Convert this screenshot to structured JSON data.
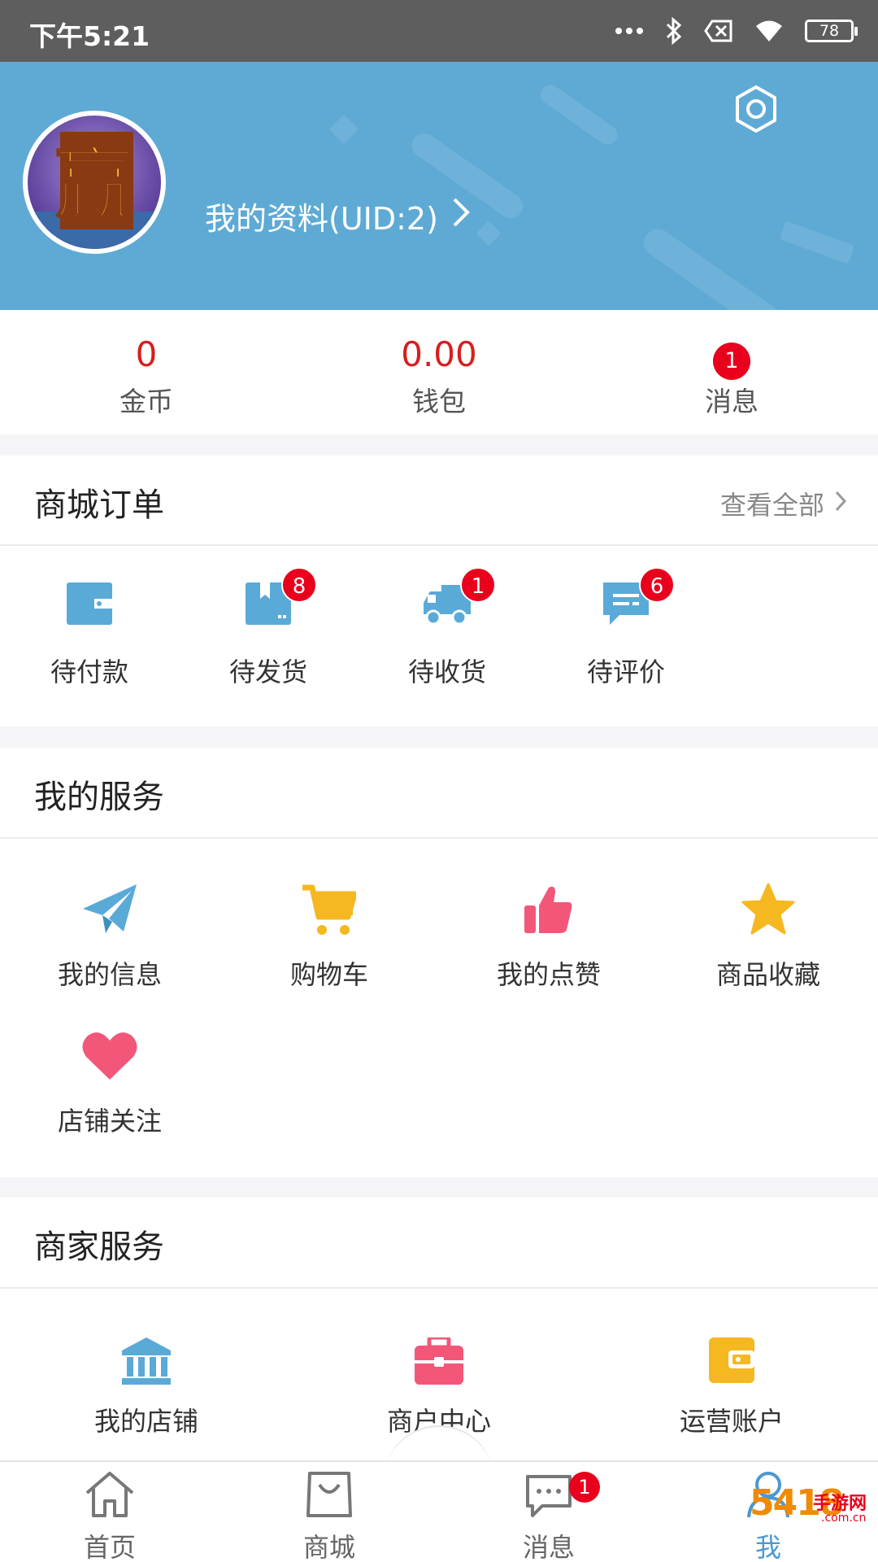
{
  "status_bar": {
    "time": "下午5:21",
    "battery": "78"
  },
  "profile": {
    "link_text": "我的资料(UID:2)",
    "avatar_glyph": "赢"
  },
  "stats": [
    {
      "value": "0",
      "label": "金币"
    },
    {
      "value": "0.00",
      "label": "钱包"
    },
    {
      "badge": "1",
      "label": "消息"
    }
  ],
  "orders": {
    "title": "商城订单",
    "view_all": "查看全部",
    "items": [
      {
        "label": "待付款",
        "icon": "wallet-icon"
      },
      {
        "label": "待发货",
        "icon": "package-icon",
        "badge": "8"
      },
      {
        "label": "待收货",
        "icon": "truck-icon",
        "badge": "1"
      },
      {
        "label": "待评价",
        "icon": "comment-icon",
        "badge": "6"
      }
    ]
  },
  "services": {
    "title": "我的服务",
    "items": [
      {
        "label": "我的信息",
        "icon": "paper-plane-icon"
      },
      {
        "label": "购物车",
        "icon": "cart-icon"
      },
      {
        "label": "我的点赞",
        "icon": "thumbs-up-icon"
      },
      {
        "label": "商品收藏",
        "icon": "star-icon"
      },
      {
        "label": "店铺关注",
        "icon": "heart-icon"
      }
    ]
  },
  "merchant": {
    "title": "商家服务",
    "items": [
      {
        "label": "我的店铺",
        "icon": "bank-icon"
      },
      {
        "label": "商户中心",
        "icon": "briefcase-icon"
      },
      {
        "label": "运营账户",
        "icon": "wallet-icon"
      }
    ]
  },
  "bottom_nav": [
    {
      "label": "首页",
      "icon": "home-icon"
    },
    {
      "label": "商城",
      "icon": "shopping-bag-icon"
    },
    {
      "label": "消息",
      "icon": "chat-icon",
      "badge": "1"
    },
    {
      "label": "我",
      "icon": "user-icon",
      "active": true
    }
  ],
  "watermark": {
    "number": "5418",
    "site": "手游网",
    "domain": ".com.cn"
  },
  "colors": {
    "header_bg": "#5eaad5",
    "accent_red": "#d81e1e",
    "badge_red": "#e8001c",
    "icon_blue": "#5aaad8",
    "cart_orange": "#f5b820",
    "pink": "#f2577a",
    "nav_active": "#4a98d4"
  }
}
